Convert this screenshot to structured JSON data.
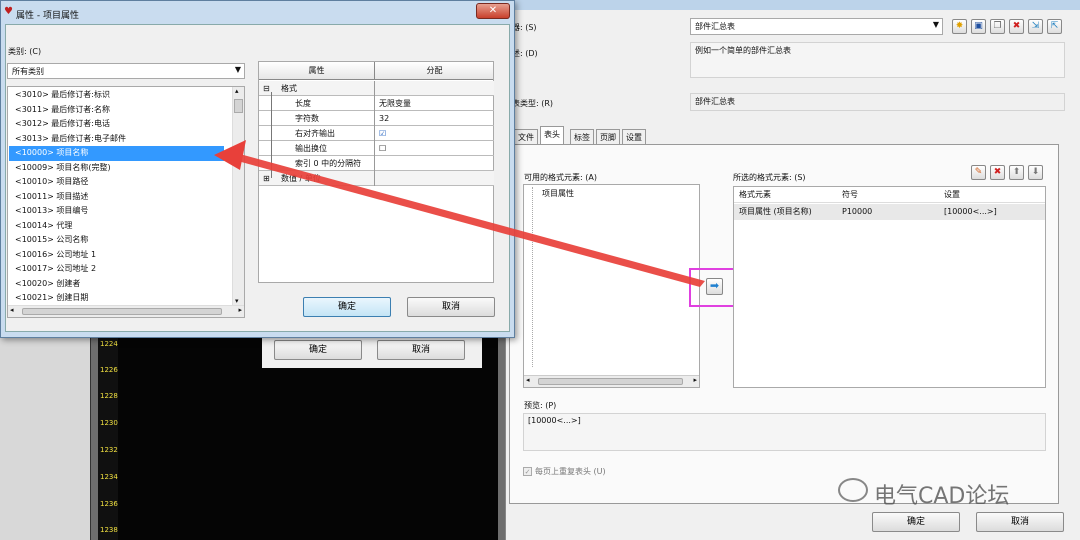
{
  "main": {
    "name_label": "器: (S)",
    "name_value": "部件汇总表",
    "desc_label": "述: (D)",
    "desc_value": "例如一个简单的部件汇总表",
    "type_label": "表类型: (R)",
    "type_value": "部件汇总表",
    "tabs": [
      {
        "label": "文件"
      },
      {
        "label": "表头"
      },
      {
        "label": "标签"
      },
      {
        "label": "页脚"
      },
      {
        "label": "设置"
      }
    ],
    "available_label": "可用的格式元素: (A)",
    "available_items": [
      "项目属性"
    ],
    "selected_label": "所选的格式元素: (S)",
    "selected_headers": [
      "格式元素",
      "符号",
      "设置"
    ],
    "selected_rows": [
      [
        "项目属性 (项目名称)",
        "P10000",
        "[10000<...>]"
      ]
    ],
    "preview_label": "预览: (P)",
    "preview_value": "[10000<...>]",
    "repeat_label": "每页上重复表头 (U)",
    "ok_label": "确定",
    "cancel_label": "取消"
  },
  "bg_dialog": {
    "ok_label": "确定",
    "cancel_label": "取消"
  },
  "ruler_values": [
    "1224",
    "1226",
    "1228",
    "1230",
    "1232",
    "1234",
    "1236",
    "1238"
  ],
  "popup": {
    "title": "属性 - 项目属性",
    "category_label": "类别: (C)",
    "category_value": "所有类别",
    "list_items": [
      "<3010> 最后修订者:标识",
      "<3011> 最后修订者:名称",
      "<3012> 最后修订者:电话",
      "<3013> 最后修订者:电子邮件",
      "<10000> 项目名称",
      "<10009> 项目名称(完整)",
      "<10010> 项目路径",
      "<10011> 项目描述",
      "<10013> 项目编号",
      "<10014> 代理",
      "<10015> 公司名称",
      "<10016> 公司地址 1",
      "<10017> 公司地址 2",
      "<10020> 创建者",
      "<10021> 创建日期"
    ],
    "selected_index": 4,
    "grid_headers": [
      "属性",
      "分配"
    ],
    "grid_rows": [
      {
        "k": "格式",
        "v": ""
      },
      {
        "k": "长度",
        "v": "无限变量"
      },
      {
        "k": "字符数",
        "v": "32"
      },
      {
        "k": "右对齐输出",
        "v": "☑"
      },
      {
        "k": "输出换位",
        "v": "☐"
      },
      {
        "k": "索引 0 中的分隔符",
        "v": ""
      },
      {
        "k": "数值 / 单位",
        "v": ""
      }
    ],
    "ok_label": "确定",
    "cancel_label": "取消",
    "close_label": "✕"
  },
  "watermark": "电气CAD论坛",
  "colors": {
    "arrow": "#e8403a",
    "highlight": "#e040e0",
    "selection": "#3399ff"
  }
}
